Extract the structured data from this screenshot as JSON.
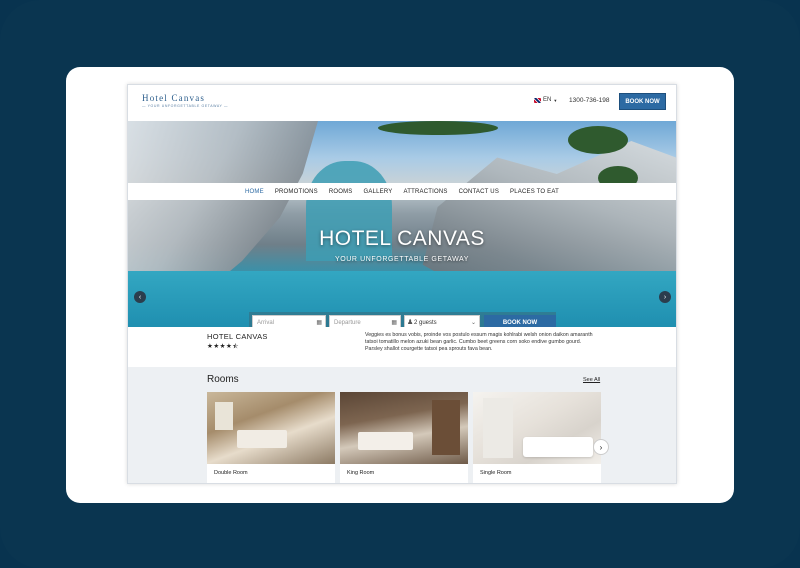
{
  "header": {
    "logo_name": "Hotel Canvas",
    "logo_tagline": "— YOUR UNFORGETTABLE GETAWAY —",
    "language": "EN",
    "phone": "1300-736-198",
    "book_now": "BOOK NOW"
  },
  "nav": {
    "items": [
      {
        "label": "HOME",
        "active": true
      },
      {
        "label": "PROMOTIONS",
        "active": false
      },
      {
        "label": "ROOMS",
        "active": false
      },
      {
        "label": "GALLERY",
        "active": false
      },
      {
        "label": "ATTRACTIONS",
        "active": false
      },
      {
        "label": "CONTACT US",
        "active": false
      },
      {
        "label": "PLACES TO EAT",
        "active": false
      }
    ]
  },
  "hero": {
    "title": "HOTEL CANVAS",
    "subtitle": "YOUR UNFORGETTABLE GETAWAY",
    "prev_icon": "chevron-left-icon",
    "next_icon": "chevron-right-icon"
  },
  "booking": {
    "arrival_placeholder": "Arrival",
    "departure_placeholder": "Departure",
    "guests_value": "2 guests",
    "submit_label": "BOOK NOW",
    "calendar_icon": "calendar-icon",
    "person_icon": "person-icon"
  },
  "info": {
    "hotel_name": "HOTEL CANVAS",
    "rating_stars": 4.5,
    "description": "Veggies es bonus vobis, proinde vos postulo essum magis kohlrabi welsh onion daikon amaranth tatsoi tomatillo melon azuki bean garlic. Cumbo beet greens corn soko endive gumbo gourd. Parsley shallot courgette tatsoi pea sprouts fava bean."
  },
  "rooms": {
    "title": "Rooms",
    "see_all": "See All",
    "items": [
      {
        "label": "Double Room"
      },
      {
        "label": "King Room"
      },
      {
        "label": "Single Room"
      }
    ],
    "next_icon": "chevron-right-icon"
  },
  "colors": {
    "accent": "#2c6aa3",
    "background": "#0a3550",
    "rooms_bg": "#edf0f3"
  }
}
